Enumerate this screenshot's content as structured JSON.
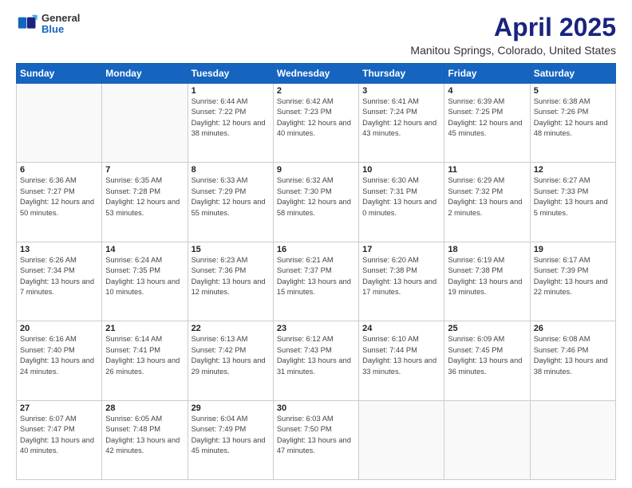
{
  "header": {
    "logo_general": "General",
    "logo_blue": "Blue",
    "main_title": "April 2025",
    "subtitle": "Manitou Springs, Colorado, United States"
  },
  "calendar": {
    "days_of_week": [
      "Sunday",
      "Monday",
      "Tuesday",
      "Wednesday",
      "Thursday",
      "Friday",
      "Saturday"
    ],
    "weeks": [
      [
        {
          "day": "",
          "info": ""
        },
        {
          "day": "",
          "info": ""
        },
        {
          "day": "1",
          "info": "Sunrise: 6:44 AM\nSunset: 7:22 PM\nDaylight: 12 hours and 38 minutes."
        },
        {
          "day": "2",
          "info": "Sunrise: 6:42 AM\nSunset: 7:23 PM\nDaylight: 12 hours and 40 minutes."
        },
        {
          "day": "3",
          "info": "Sunrise: 6:41 AM\nSunset: 7:24 PM\nDaylight: 12 hours and 43 minutes."
        },
        {
          "day": "4",
          "info": "Sunrise: 6:39 AM\nSunset: 7:25 PM\nDaylight: 12 hours and 45 minutes."
        },
        {
          "day": "5",
          "info": "Sunrise: 6:38 AM\nSunset: 7:26 PM\nDaylight: 12 hours and 48 minutes."
        }
      ],
      [
        {
          "day": "6",
          "info": "Sunrise: 6:36 AM\nSunset: 7:27 PM\nDaylight: 12 hours and 50 minutes."
        },
        {
          "day": "7",
          "info": "Sunrise: 6:35 AM\nSunset: 7:28 PM\nDaylight: 12 hours and 53 minutes."
        },
        {
          "day": "8",
          "info": "Sunrise: 6:33 AM\nSunset: 7:29 PM\nDaylight: 12 hours and 55 minutes."
        },
        {
          "day": "9",
          "info": "Sunrise: 6:32 AM\nSunset: 7:30 PM\nDaylight: 12 hours and 58 minutes."
        },
        {
          "day": "10",
          "info": "Sunrise: 6:30 AM\nSunset: 7:31 PM\nDaylight: 13 hours and 0 minutes."
        },
        {
          "day": "11",
          "info": "Sunrise: 6:29 AM\nSunset: 7:32 PM\nDaylight: 13 hours and 2 minutes."
        },
        {
          "day": "12",
          "info": "Sunrise: 6:27 AM\nSunset: 7:33 PM\nDaylight: 13 hours and 5 minutes."
        }
      ],
      [
        {
          "day": "13",
          "info": "Sunrise: 6:26 AM\nSunset: 7:34 PM\nDaylight: 13 hours and 7 minutes."
        },
        {
          "day": "14",
          "info": "Sunrise: 6:24 AM\nSunset: 7:35 PM\nDaylight: 13 hours and 10 minutes."
        },
        {
          "day": "15",
          "info": "Sunrise: 6:23 AM\nSunset: 7:36 PM\nDaylight: 13 hours and 12 minutes."
        },
        {
          "day": "16",
          "info": "Sunrise: 6:21 AM\nSunset: 7:37 PM\nDaylight: 13 hours and 15 minutes."
        },
        {
          "day": "17",
          "info": "Sunrise: 6:20 AM\nSunset: 7:38 PM\nDaylight: 13 hours and 17 minutes."
        },
        {
          "day": "18",
          "info": "Sunrise: 6:19 AM\nSunset: 7:38 PM\nDaylight: 13 hours and 19 minutes."
        },
        {
          "day": "19",
          "info": "Sunrise: 6:17 AM\nSunset: 7:39 PM\nDaylight: 13 hours and 22 minutes."
        }
      ],
      [
        {
          "day": "20",
          "info": "Sunrise: 6:16 AM\nSunset: 7:40 PM\nDaylight: 13 hours and 24 minutes."
        },
        {
          "day": "21",
          "info": "Sunrise: 6:14 AM\nSunset: 7:41 PM\nDaylight: 13 hours and 26 minutes."
        },
        {
          "day": "22",
          "info": "Sunrise: 6:13 AM\nSunset: 7:42 PM\nDaylight: 13 hours and 29 minutes."
        },
        {
          "day": "23",
          "info": "Sunrise: 6:12 AM\nSunset: 7:43 PM\nDaylight: 13 hours and 31 minutes."
        },
        {
          "day": "24",
          "info": "Sunrise: 6:10 AM\nSunset: 7:44 PM\nDaylight: 13 hours and 33 minutes."
        },
        {
          "day": "25",
          "info": "Sunrise: 6:09 AM\nSunset: 7:45 PM\nDaylight: 13 hours and 36 minutes."
        },
        {
          "day": "26",
          "info": "Sunrise: 6:08 AM\nSunset: 7:46 PM\nDaylight: 13 hours and 38 minutes."
        }
      ],
      [
        {
          "day": "27",
          "info": "Sunrise: 6:07 AM\nSunset: 7:47 PM\nDaylight: 13 hours and 40 minutes."
        },
        {
          "day": "28",
          "info": "Sunrise: 6:05 AM\nSunset: 7:48 PM\nDaylight: 13 hours and 42 minutes."
        },
        {
          "day": "29",
          "info": "Sunrise: 6:04 AM\nSunset: 7:49 PM\nDaylight: 13 hours and 45 minutes."
        },
        {
          "day": "30",
          "info": "Sunrise: 6:03 AM\nSunset: 7:50 PM\nDaylight: 13 hours and 47 minutes."
        },
        {
          "day": "",
          "info": ""
        },
        {
          "day": "",
          "info": ""
        },
        {
          "day": "",
          "info": ""
        }
      ]
    ]
  }
}
